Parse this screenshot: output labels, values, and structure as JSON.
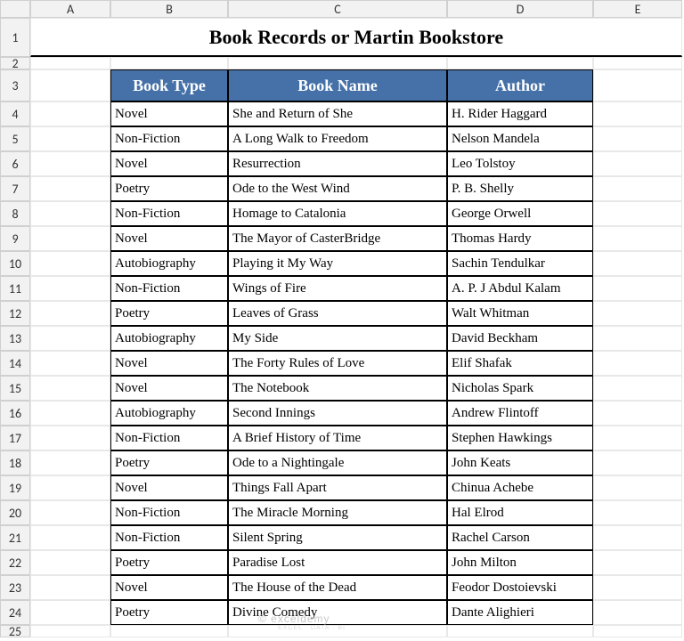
{
  "columns": [
    "A",
    "B",
    "C",
    "D",
    "E"
  ],
  "title": "Book Records or Martin Bookstore",
  "headers": {
    "b": "Book Type",
    "c": "Book Name",
    "d": "Author"
  },
  "rows": [
    {
      "n": 4,
      "b": "Novel",
      "c": "She and Return of She",
      "d": "H. Rider Haggard"
    },
    {
      "n": 5,
      "b": "Non-Fiction",
      "c": "A Long Walk to Freedom",
      "d": "Nelson Mandela"
    },
    {
      "n": 6,
      "b": "Novel",
      "c": "Resurrection",
      "d": "Leo Tolstoy"
    },
    {
      "n": 7,
      "b": "Poetry",
      "c": "Ode to the West Wind",
      "d": "P. B. Shelly"
    },
    {
      "n": 8,
      "b": "Non-Fiction",
      "c": "Homage to Catalonia",
      "d": "George Orwell"
    },
    {
      "n": 9,
      "b": "Novel",
      "c": "The Mayor of CasterBridge",
      "d": "Thomas Hardy"
    },
    {
      "n": 10,
      "b": "Autobiography",
      "c": "Playing it My Way",
      "d": "Sachin Tendulkar"
    },
    {
      "n": 11,
      "b": "Non-Fiction",
      "c": "Wings of Fire",
      "d": "A. P. J Abdul Kalam"
    },
    {
      "n": 12,
      "b": "Poetry",
      "c": "Leaves of Grass",
      "d": "Walt Whitman"
    },
    {
      "n": 13,
      "b": "Autobiography",
      "c": "My Side",
      "d": "David Beckham"
    },
    {
      "n": 14,
      "b": "Novel",
      "c": "The Forty Rules of Love",
      "d": "Elif Shafak"
    },
    {
      "n": 15,
      "b": "Novel",
      "c": "The Notebook",
      "d": "Nicholas Spark"
    },
    {
      "n": 16,
      "b": "Autobiography",
      "c": "Second Innings",
      "d": "Andrew Flintoff"
    },
    {
      "n": 17,
      "b": "Non-Fiction",
      "c": "A Brief History of Time",
      "d": "Stephen Hawkings"
    },
    {
      "n": 18,
      "b": "Poetry",
      "c": "Ode to a Nightingale",
      "d": "John Keats"
    },
    {
      "n": 19,
      "b": "Novel",
      "c": "Things Fall Apart",
      "d": "Chinua Achebe"
    },
    {
      "n": 20,
      "b": "Non-Fiction",
      "c": "The Miracle Morning",
      "d": "Hal Elrod"
    },
    {
      "n": 21,
      "b": "Non-Fiction",
      "c": "Silent Spring",
      "d": "Rachel Carson"
    },
    {
      "n": 22,
      "b": "Poetry",
      "c": "Paradise Lost",
      "d": "John Milton"
    },
    {
      "n": 23,
      "b": "Novel",
      "c": "The House of the Dead",
      "d": "Feodor Dostoievski"
    },
    {
      "n": 24,
      "b": "Poetry",
      "c": "Divine Comedy",
      "d": "Dante Alighieri"
    }
  ],
  "lastRow": 25,
  "watermark": "© exceldemy",
  "watermarkSub": "EXCEL · DATA · BI"
}
